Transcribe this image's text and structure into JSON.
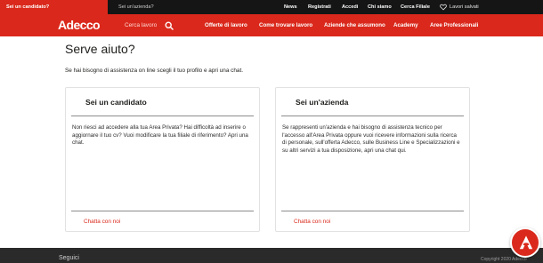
{
  "topbar": {
    "candidate_tab": "Sei un candidato?",
    "company_tab": "Sei un'azienda?",
    "links": [
      "News",
      "Registrati",
      "Accedi",
      "Chi siamo",
      "Cerca Filiale"
    ],
    "saved_jobs": "Lavori salvati"
  },
  "navbar": {
    "logo": "Adecco",
    "search_placeholder": "Cerca lavoro",
    "links": [
      "Offerte di lavoro",
      "Come trovare lavoro",
      "Aziende che assumono",
      "Academy",
      "Aree Professionali"
    ]
  },
  "main": {
    "title": "Serve aiuto?",
    "intro": "Se hai bisogno di assistenza on line scegli il tuo profilo e apri una chat.",
    "cards": [
      {
        "title": "Sei un candidato",
        "body": "Non riesci ad accedere alla tua Area Privata? Hai difficoltà ad inserire o aggiornare il tuo cv? Vuoi modificare la tua filiale di riferimento? Apri una chat.",
        "link": "Chatta con noi"
      },
      {
        "title": "Sei un'azienda",
        "body": "Se rappresenti un'azienda e hai bisogno di assistenza tecnico per l'accesso all'Area Privata oppure vuoi ricevere informazioni sulla ricerca di personale, sull'offerta Adecco, sulle Business Line e Specializzazioni e su altri servizi a tua disposizione, apri una chat qui.",
        "link": "Chatta con noi"
      }
    ]
  },
  "footer": {
    "left": "Seguici",
    "right": "Copyright 2020 Adecco"
  },
  "colors": {
    "brand_red": "#da291c",
    "topbar_bg": "#151515",
    "footer_bg": "#2a2a2a"
  },
  "icons": {
    "search": "search-icon",
    "heart": "heart-icon",
    "chat_fab": "adecco-chat-icon"
  }
}
